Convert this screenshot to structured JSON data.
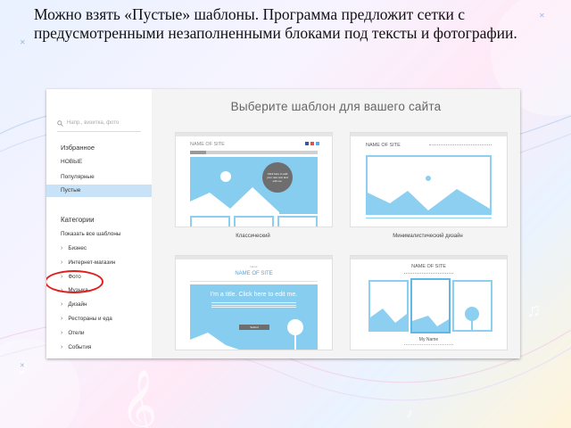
{
  "slide": {
    "text": "Можно  взять «Пустые» шаблоны. Программа предложит сетки с предусмотренными незаполненными блоками под тексты и фотографии."
  },
  "screenshot": {
    "search_placeholder": "Напр., визитка, фото",
    "nav_items": [
      "Избранное",
      "НОВЫЕ",
      "Популярные",
      "Пустые"
    ],
    "active_nav": "Пустые",
    "categories_heading": "Категории",
    "show_all": "Показать все шаблоны",
    "categories": [
      "Бизнес",
      "Интернет-магазин",
      "Фото",
      "Музыка",
      "Дизайн",
      "Рестораны и еда",
      "Отели",
      "События"
    ],
    "title": "Выберите шаблон для вашего сайта",
    "templates": [
      {
        "caption": "Классический",
        "site_name": "NAME OF SITE",
        "bubble": "Click here to add your own text and edit me."
      },
      {
        "caption": "Минималистический дизайн",
        "site_name": "NAME OF SITE"
      },
      {
        "caption": "",
        "site_name": "NAME OF SITE",
        "headline": "I'm a title. Click here to edit me.",
        "small_label": "Home",
        "button": "Submit"
      },
      {
        "caption": "",
        "site_name": "NAME OF SITE",
        "person": "My Name"
      }
    ]
  },
  "colors": {
    "accent_blue": "#87cdef",
    "highlight_oval": "#e01e1e",
    "active_bg": "#c8e2f7"
  }
}
